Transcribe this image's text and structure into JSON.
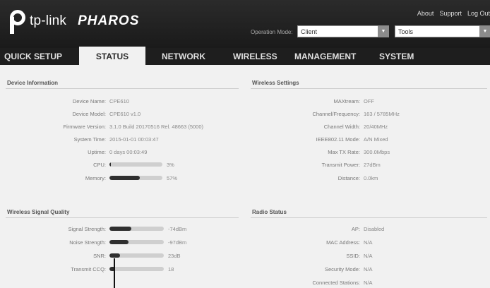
{
  "header": {
    "brand": "tp-link",
    "product": "PHAROS",
    "links": [
      "About",
      "Support",
      "Log Out"
    ],
    "operation_mode_label": "Operation Mode:",
    "operation_mode_value": "Client",
    "tools_value": "Tools"
  },
  "nav": {
    "tabs": [
      "QUICK SETUP",
      "STATUS",
      "NETWORK",
      "WIRELESS",
      "MANAGEMENT",
      "SYSTEM"
    ],
    "active": "STATUS"
  },
  "device_info": {
    "title": "Device Information",
    "rows": [
      {
        "label": "Device Name:",
        "value": "CPE610"
      },
      {
        "label": "Device Model:",
        "value": "CPE610 v1.0"
      },
      {
        "label": "Firmware Version:",
        "value": "3.1.0 Build 20170516 Rel. 48663 (5000)"
      },
      {
        "label": "System Time:",
        "value": "2015-01-01 00:03:47"
      },
      {
        "label": "Uptime:",
        "value": "0 days 00:03:49"
      }
    ],
    "cpu": {
      "label": "CPU:",
      "percent": 3,
      "value": "3%"
    },
    "memory": {
      "label": "Memory:",
      "percent": 57,
      "value": "57%"
    }
  },
  "wireless_settings": {
    "title": "Wireless Settings",
    "rows": [
      {
        "label": "MAXtream:",
        "value": "OFF"
      },
      {
        "label": "Channel/Frequency:",
        "value": "163 / 5785MHz"
      },
      {
        "label": "Channel Width:",
        "value": "20/40MHz"
      },
      {
        "label": "IEEE802.11 Mode:",
        "value": "A/N Mixed"
      },
      {
        "label": "Max TX Rate:",
        "value": "300.0Mbps"
      },
      {
        "label": "Transmit Power:",
        "value": "27dBm"
      },
      {
        "label": "Distance:",
        "value": "0.0km"
      }
    ]
  },
  "signal_quality": {
    "title": "Wireless Signal Quality",
    "rows": [
      {
        "label": "Signal Strength:",
        "fill": 0.4,
        "value": "-74dBm"
      },
      {
        "label": "Noise Strength:",
        "fill": 0.35,
        "value": "-97dBm"
      },
      {
        "label": "SNR:",
        "fill": 0.2,
        "value": "23dB"
      },
      {
        "label": "Transmit CCQ:",
        "fill": 0.1,
        "value": "18"
      }
    ]
  },
  "radio_status": {
    "title": "Radio Status",
    "rows": [
      {
        "label": "AP:",
        "value": "Disabled"
      },
      {
        "label": "MAC Address:",
        "value": "N/A"
      },
      {
        "label": "SSID:",
        "value": "N/A"
      },
      {
        "label": "Security Mode:",
        "value": "N/A"
      },
      {
        "label": "Connected Stations:",
        "value": "N/A"
      }
    ]
  },
  "colors": {
    "header_bg": "#1f1f1f",
    "bar_fill": "#2f2f2f",
    "bar_track": "#cfcfcf",
    "page_bg": "#f1f1f1"
  }
}
